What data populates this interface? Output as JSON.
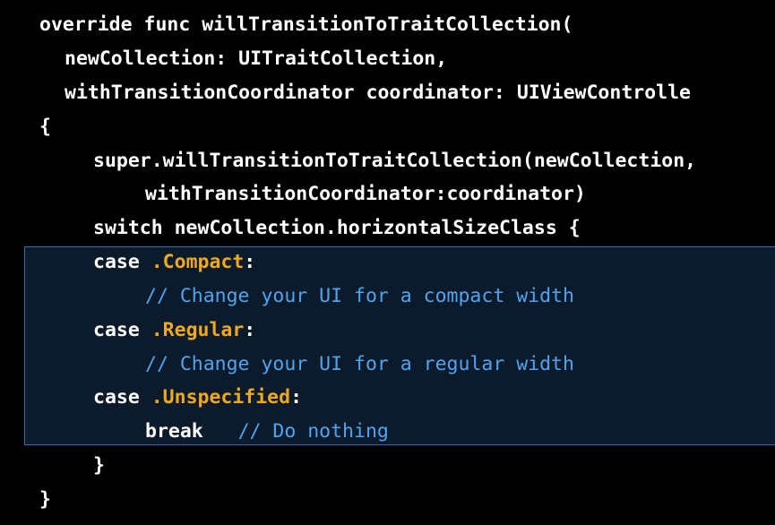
{
  "code": {
    "lines": [
      {
        "indent": "",
        "parts": [
          {
            "text": "override func willTransitionToTraitCollection(",
            "kind": "plain"
          }
        ]
      },
      {
        "indent": "  ",
        "parts": [
          {
            "text": "newCollection: UITraitCollection,",
            "kind": "plain"
          }
        ]
      },
      {
        "indent": "  ",
        "parts": [
          {
            "text": "withTransitionCoordinator coordinator: UIViewControlle",
            "kind": "plain"
          }
        ]
      },
      {
        "indent": "",
        "parts": [
          {
            "text": "{",
            "kind": "plain"
          }
        ]
      },
      {
        "indent": "    ",
        "parts": [
          {
            "text": "super.willTransitionToTraitCollection(newCollection,",
            "kind": "plain"
          }
        ]
      },
      {
        "indent": "        ",
        "parts": [
          {
            "text": "withTransitionCoordinator:coordinator)",
            "kind": "plain"
          }
        ]
      },
      {
        "indent": "    ",
        "parts": [
          {
            "text": "switch newCollection.horizontalSizeClass {",
            "kind": "plain"
          }
        ]
      },
      {
        "indent": "    ",
        "parts": [
          {
            "text": "case ",
            "kind": "plain"
          },
          {
            "text": ".Compact",
            "kind": "enum"
          },
          {
            "text": ":",
            "kind": "plain"
          }
        ]
      },
      {
        "indent": "        ",
        "parts": [
          {
            "text": "// Change your UI for a compact width",
            "kind": "comment"
          }
        ]
      },
      {
        "indent": "    ",
        "parts": [
          {
            "text": "case ",
            "kind": "plain"
          },
          {
            "text": ".Regular",
            "kind": "enum"
          },
          {
            "text": ":",
            "kind": "plain"
          }
        ]
      },
      {
        "indent": "        ",
        "parts": [
          {
            "text": "// Change your UI for a regular width",
            "kind": "comment"
          }
        ]
      },
      {
        "indent": "    ",
        "parts": [
          {
            "text": "case ",
            "kind": "plain"
          },
          {
            "text": ".Unspecified",
            "kind": "enum"
          },
          {
            "text": ":",
            "kind": "plain"
          }
        ]
      },
      {
        "indent": "        ",
        "parts": [
          {
            "text": "break   ",
            "kind": "plain"
          },
          {
            "text": "// Do nothing",
            "kind": "comment"
          }
        ]
      },
      {
        "indent": "    ",
        "parts": [
          {
            "text": "}",
            "kind": "plain"
          }
        ]
      },
      {
        "indent": "",
        "parts": [
          {
            "text": "}",
            "kind": "plain"
          }
        ]
      }
    ]
  },
  "colors": {
    "background": "#000000",
    "text": "#ffffff",
    "comment": "#4fa4f0",
    "enum_case": "#f0a81e",
    "selection_fill": "#0c1b2c",
    "selection_border": "#2f6fb0"
  }
}
